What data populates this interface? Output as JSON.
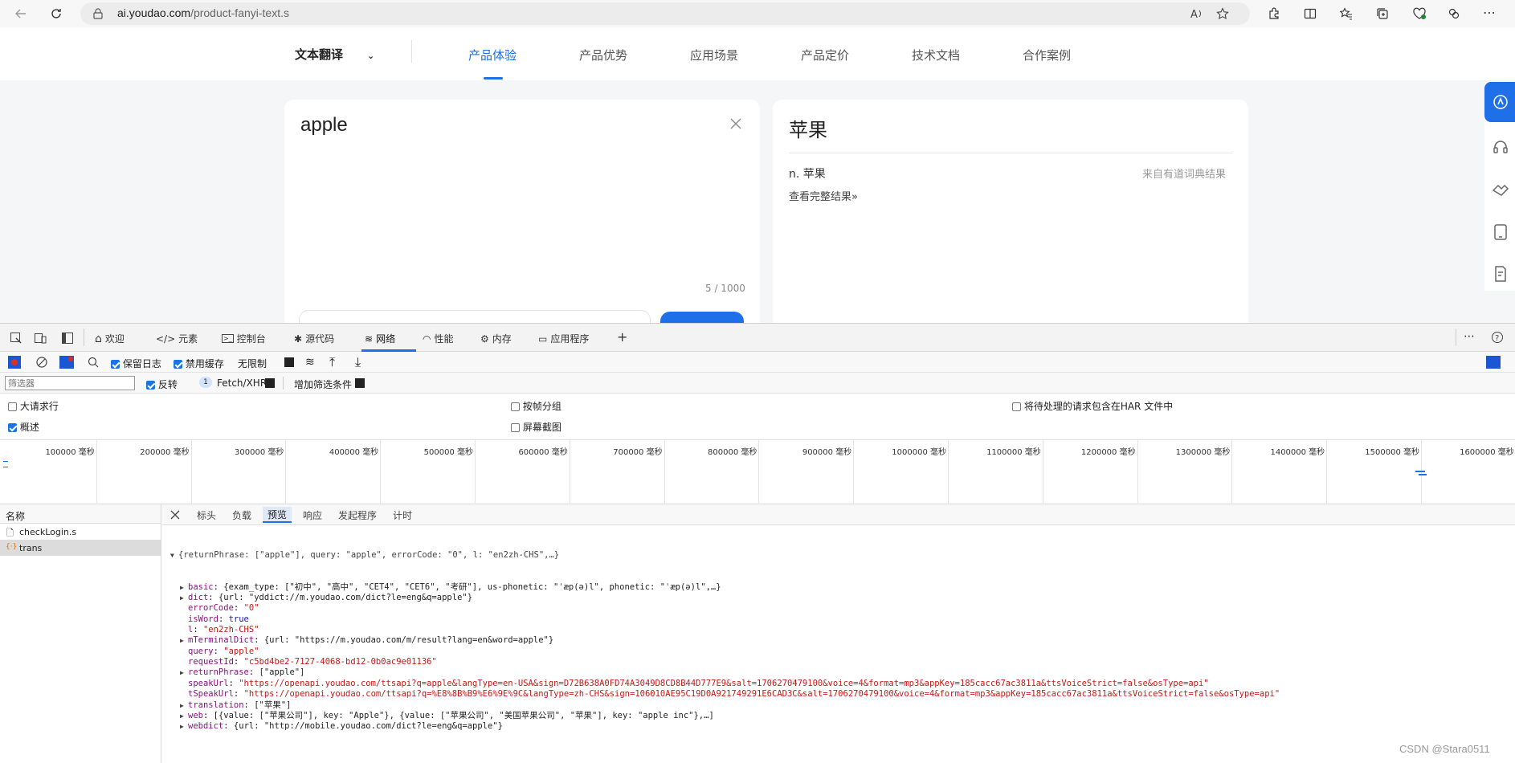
{
  "browser": {
    "url_domain": "ai.youdao.com",
    "url_path": "/product-fanyi-text.s"
  },
  "site": {
    "product_select": "文本翻译",
    "nav": [
      "产品体验",
      "产品优势",
      "应用场景",
      "产品定价",
      "技术文档",
      "合作案例"
    ],
    "input_text": "apple",
    "char_count": "5 / 1000",
    "output_text": "苹果",
    "dict_def": "n. 苹果",
    "dict_source": "来自有道词典结果",
    "full_result_link": "查看完整结果»"
  },
  "devtools": {
    "tabs": [
      "欢迎",
      "元素",
      "控制台",
      "源代码",
      "网络",
      "性能",
      "内存",
      "应用程序"
    ],
    "toolbar": {
      "preserve_log": "保留日志",
      "disable_cache": "禁用缓存",
      "throttle": "无限制"
    },
    "filter": {
      "placeholder": "筛选器",
      "invert": "反转",
      "badge": "1",
      "type": "Fetch/XHR",
      "more": "增加筛选条件"
    },
    "options": {
      "big_rows": "大请求行",
      "group_by_frame": "按帧分组",
      "har": "将待处理的请求包含在HAR 文件中",
      "overview": "概述",
      "screenshots": "屏幕截图"
    },
    "timeline_labels": [
      "100000 毫秒",
      "200000 毫秒",
      "300000 毫秒",
      "400000 毫秒",
      "500000 毫秒",
      "600000 毫秒",
      "700000 毫秒",
      "800000 毫秒",
      "900000 毫秒",
      "1000000 毫秒",
      "1100000 毫秒",
      "1200000 毫秒",
      "1300000 毫秒",
      "1400000 毫秒",
      "1500000 毫秒",
      "1600000 毫秒"
    ],
    "request_list": {
      "header": "名称",
      "items": [
        "checkLogin.s",
        "trans"
      ]
    },
    "detail_tabs": [
      "标头",
      "负载",
      "预览",
      "响应",
      "发起程序",
      "计时"
    ],
    "preview": {
      "summary": "{returnPhrase: [\"apple\"], query: \"apple\", errorCode: \"0\", l: \"en2zh-CHS\",…}",
      "lines": [
        {
          "indent": 1,
          "arrow": true,
          "key": "basic",
          "value": "{exam_type: [\"初中\", \"高中\", \"CET4\", \"CET6\", \"考研\"], us-phonetic: \"ˈæp(ə)l\", phonetic: \"ˈæp(ə)l\",…}",
          "kind": "obj"
        },
        {
          "indent": 1,
          "arrow": true,
          "key": "dict",
          "value": "{url: \"yddict://m.youdao.com/dict?le=eng&q=apple\"}",
          "kind": "obj"
        },
        {
          "indent": 1,
          "arrow": false,
          "key": "errorCode",
          "value": "\"0\"",
          "kind": "str"
        },
        {
          "indent": 1,
          "arrow": false,
          "key": "isWord",
          "value": "true",
          "kind": "bool"
        },
        {
          "indent": 1,
          "arrow": false,
          "key": "l",
          "value": "\"en2zh-CHS\"",
          "kind": "str"
        },
        {
          "indent": 1,
          "arrow": true,
          "key": "mTerminalDict",
          "value": "{url: \"https://m.youdao.com/m/result?lang=en&word=apple\"}",
          "kind": "obj"
        },
        {
          "indent": 1,
          "arrow": false,
          "key": "query",
          "value": "\"apple\"",
          "kind": "str"
        },
        {
          "indent": 1,
          "arrow": false,
          "key": "requestId",
          "value": "\"c5bd4be2-7127-4068-bd12-0b0ac9e01136\"",
          "kind": "str"
        },
        {
          "indent": 1,
          "arrow": true,
          "key": "returnPhrase",
          "value": "[\"apple\"]",
          "kind": "obj"
        },
        {
          "indent": 1,
          "arrow": false,
          "key": "speakUrl",
          "value": "\"https://openapi.youdao.com/ttsapi?q=apple&langType=en-USA&sign=D72B638A0FD74A3049D8CD8B44D777E9&salt=1706270479100&voice=4&format=mp3&appKey=185cacc67ac3811a&ttsVoiceStrict=false&osType=api\"",
          "kind": "str"
        },
        {
          "indent": 1,
          "arrow": false,
          "key": "tSpeakUrl",
          "value": "\"https://openapi.youdao.com/ttsapi?q=%E8%8B%B9%E6%9E%9C&langType=zh-CHS&sign=106010AE95C19D0A921749291E6CAD3C&salt=1706270479100&voice=4&format=mp3&appKey=185cacc67ac3811a&ttsVoiceStrict=false&osType=api\"",
          "kind": "str"
        },
        {
          "indent": 1,
          "arrow": true,
          "key": "translation",
          "value": "[\"苹果\"]",
          "kind": "obj"
        },
        {
          "indent": 1,
          "arrow": true,
          "key": "web",
          "value": "[{value: [\"苹果公司\"], key: \"Apple\"}, {value: [\"苹果公司\", \"美国苹果公司\", \"苹果\"], key: \"apple inc\"},…]",
          "kind": "obj"
        },
        {
          "indent": 1,
          "arrow": true,
          "key": "webdict",
          "value": "{url: \"http://mobile.youdao.com/dict?le=eng&q=apple\"}",
          "kind": "obj"
        }
      ]
    }
  },
  "watermark": "CSDN @Stara0511",
  "colors": {
    "accent": "#1e6fe8",
    "key": "#881280",
    "string": "#c41a16",
    "bool": "#1a1aa6"
  }
}
